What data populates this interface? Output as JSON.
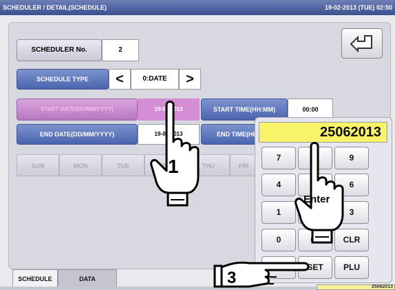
{
  "titlebar": {
    "title": "SCHEDULER / DETAIL(SCHEDULE)",
    "datetime": "19-02-2013 (TUE) 02:50"
  },
  "scheduler": {
    "no_label": "SCHEDULER No.",
    "no_value": "2",
    "type_label": "SCHEDULE TYPE",
    "type_value": "0:DATE",
    "prev_glyph": "<",
    "next_glyph": ">"
  },
  "dates": {
    "start_date_label": "START DATE(DD/MM/YYYY)",
    "start_date_value": "19-02-2013",
    "start_time_label": "START TIME(HH:MM)",
    "start_time_value": "00:00",
    "end_date_label": "END DATE(DD/MM/YYYY)",
    "end_date_value": "19-02-2013",
    "end_time_label": "END TIME(HH:MM)"
  },
  "days": [
    "SUN",
    "MON",
    "TUE",
    "WED",
    "THU",
    "FRI"
  ],
  "keypad": {
    "display": "25062013",
    "keys": [
      "7",
      "8",
      "9",
      "4",
      "5",
      "6",
      "1",
      "2",
      "3",
      "0",
      "00",
      "CLR",
      "",
      "SET",
      "PLU"
    ]
  },
  "tabs": {
    "schedule": "SCHEDULE",
    "data": "DATA"
  },
  "status_value": "25062013",
  "annotations": {
    "step1": "1",
    "enter": "Enter",
    "step3": "3"
  }
}
